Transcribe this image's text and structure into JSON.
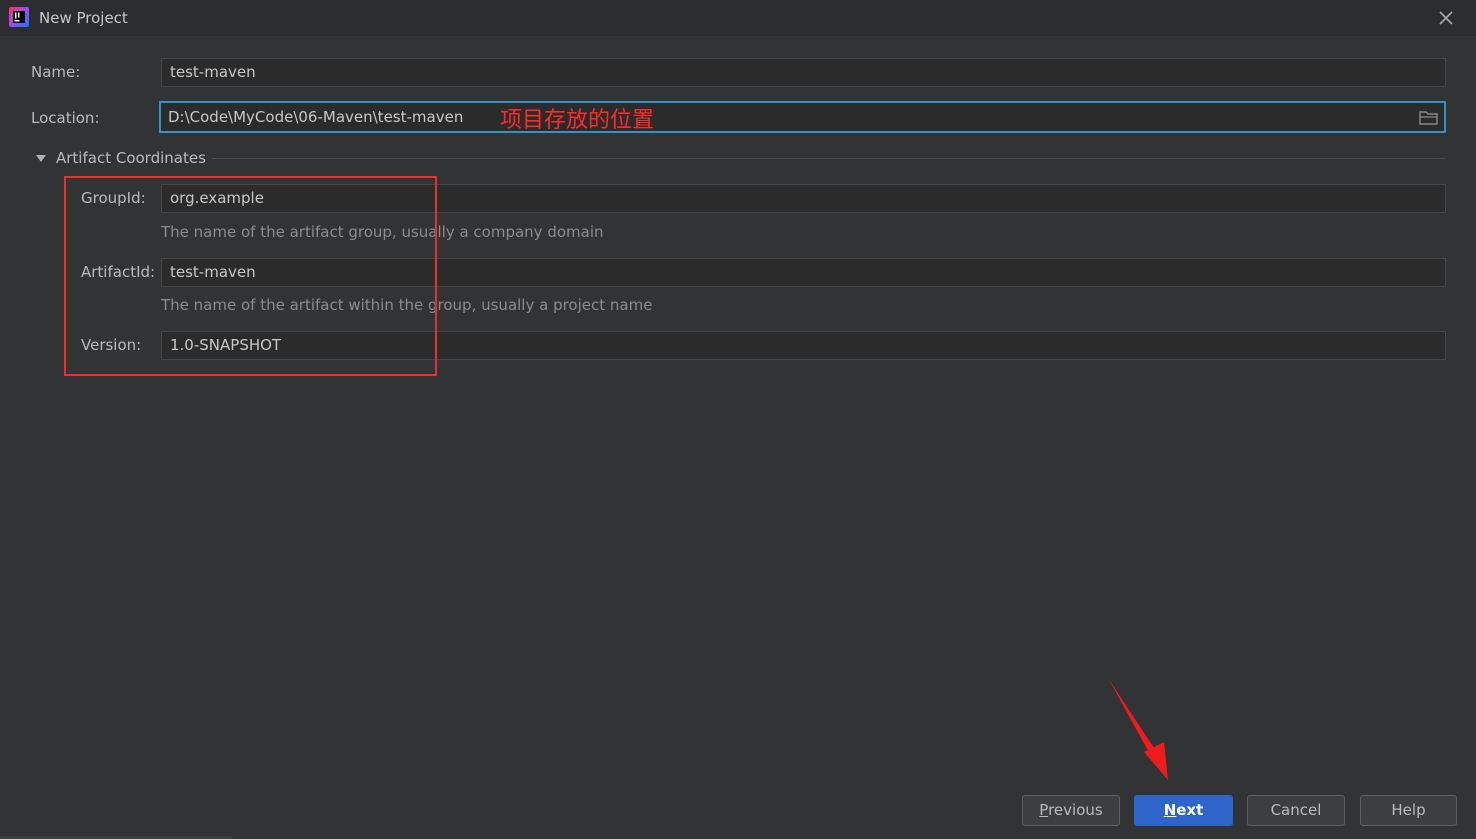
{
  "window": {
    "title": "New Project",
    "icon": "intellij-idea-icon",
    "close_icon": "close-icon"
  },
  "form": {
    "name_label": "Name:",
    "name_value": "test-maven",
    "location_label": "Location:",
    "location_value": "D:\\Code\\MyCode\\06-Maven\\test-maven",
    "annotation": "项目存放的位置",
    "browse_icon": "folder-icon"
  },
  "artifact": {
    "section_title": "Artifact Coordinates",
    "groupid_label": "GroupId:",
    "groupid_value": "org.example",
    "groupid_hint": "The name of the artifact group, usually a company domain",
    "artifactid_label": "ArtifactId:",
    "artifactid_value": "test-maven",
    "artifactid_hint": "The name of the artifact within the group, usually a project name",
    "version_label": "Version:",
    "version_value": "1.0-SNAPSHOT"
  },
  "buttons": {
    "previous_mnemonic": "P",
    "previous_rest": "revious",
    "next_mnemonic": "N",
    "next_rest": "ext",
    "cancel": "Cancel",
    "help": "Help"
  },
  "colors": {
    "background": "#313335",
    "accent": "#3592c4",
    "annotation": "#ff2a2a",
    "primary_button": "#2f65ca"
  }
}
